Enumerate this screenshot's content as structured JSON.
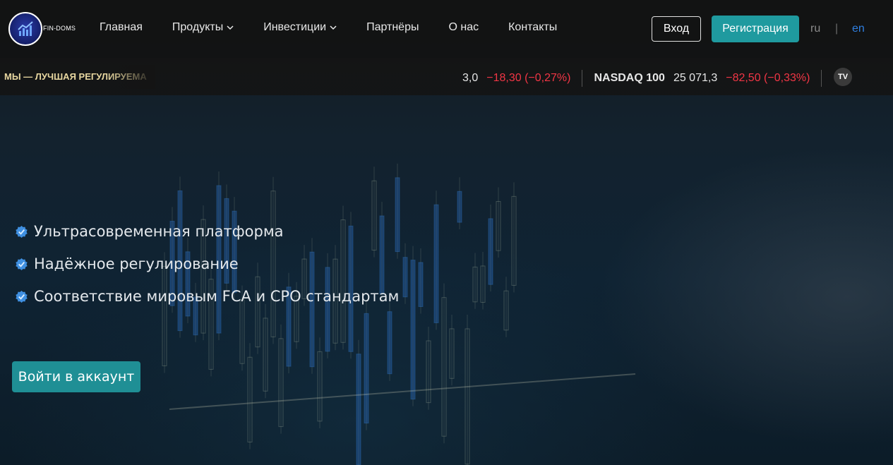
{
  "brand": {
    "logo_text": "FIN-DOMS"
  },
  "nav": {
    "items": [
      {
        "label": "Главная",
        "has_dropdown": false
      },
      {
        "label": "Продукты",
        "has_dropdown": true
      },
      {
        "label": "Инвестиции",
        "has_dropdown": true
      },
      {
        "label": "Партнёры",
        "has_dropdown": false
      },
      {
        "label": "О нас",
        "has_dropdown": false
      },
      {
        "label": "Контакты",
        "has_dropdown": false
      }
    ]
  },
  "auth": {
    "login_label": "Вход",
    "register_label": "Регистрация"
  },
  "lang": {
    "ru": "ru",
    "separator": "|",
    "en": "en",
    "active": "en"
  },
  "ticker": {
    "marquee_text": "МЫ — ЛУЧШАЯ РЕГУЛИРУЕМА",
    "quotes": [
      {
        "name": "",
        "value": "3,0",
        "change": "−18,30 (−0,27%)"
      },
      {
        "name": "NASDAQ 100",
        "value": "25 071,3",
        "change": "−82,50 (−0,33%)"
      }
    ],
    "badge": "TV"
  },
  "features": [
    {
      "text": "Ультрасовременная платформа",
      "icon": "verified-check-icon"
    },
    {
      "text": "Надёжное регулирование",
      "icon": "verified-check-icon"
    },
    {
      "text": "Соответствие мировым FCA и CPO стандартам",
      "icon": "verified-check-icon"
    }
  ],
  "cta": {
    "label": "Войти в аккаунт"
  },
  "colors": {
    "accent": "#1f9a9f",
    "negative": "#f23645",
    "lang_active": "#2f7fe0",
    "marquee": "#e8d7a0"
  }
}
